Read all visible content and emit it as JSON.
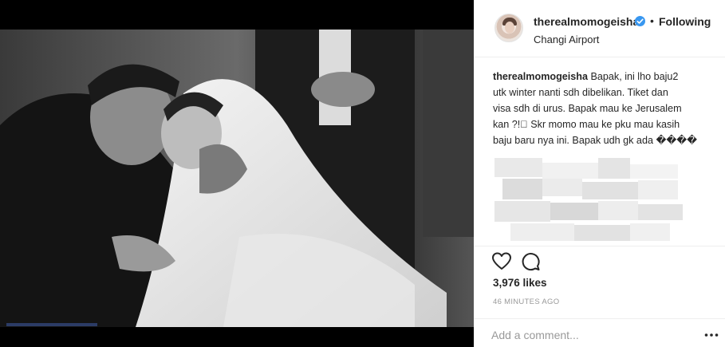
{
  "post": {
    "photo_alt": "",
    "username": "therealmomogeisha",
    "follow_state": "Following",
    "separator": "•",
    "location": "Changi Airport",
    "caption": {
      "username": "therealmomogeisha",
      "first_line": "Bapak, ini lho baju2",
      "lines": [
        "utk winter nanti sdh dibelikan. Tiket dan",
        "visa sdh di urus. Bapak mau ke Jerusalem",
        "kan ?!􏿽 Skr momo mau ke pku mau kasih",
        "baju baru nya ini. Bapak udh gk ada ����"
      ]
    },
    "likes": "3,976 likes",
    "timestamp": "46 MINUTES AGO",
    "comment_placeholder": "Add a comment...",
    "more_label": "•••"
  },
  "icons": {
    "verified": "verified-badge-icon",
    "like": "heart-icon",
    "comment": "comment-bubble-icon",
    "more": "more-options-icon"
  },
  "colors": {
    "verified_blue": "#3897f0",
    "text": "#262626",
    "muted": "#999999",
    "divider": "#efefef",
    "photo_background": "#000000"
  }
}
